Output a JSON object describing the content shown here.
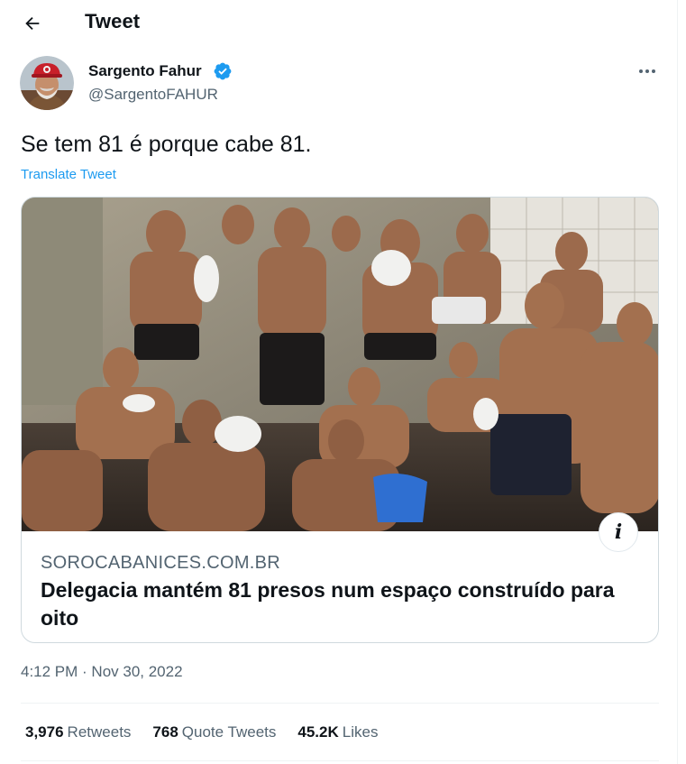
{
  "header": {
    "title": "Tweet",
    "back_icon": "arrow-left-icon"
  },
  "author": {
    "name": "Sargento Fahur",
    "handle": "@SargentoFAHUR",
    "verified": true,
    "verified_color": "#1d9bf0"
  },
  "tweet": {
    "text": "Se tem 81 é porque cabe 81.",
    "translate_label": "Translate Tweet",
    "timestamp": "4:12 PM · Nov 30, 2022"
  },
  "card": {
    "domain": "SOROCABANICES.COM.BR",
    "title": "Delegacia mantém 81 presos num espaço construído para oito",
    "info_glyph": "i"
  },
  "stats": {
    "retweets": {
      "count": "3,976",
      "label": "Retweets"
    },
    "quotes": {
      "count": "768",
      "label": "Quote Tweets"
    },
    "likes": {
      "count": "45.2K",
      "label": "Likes"
    }
  },
  "colors": {
    "accent": "#1d9bf0",
    "text_primary": "#0f1419",
    "text_secondary": "#536471",
    "border": "#cfd9de"
  }
}
